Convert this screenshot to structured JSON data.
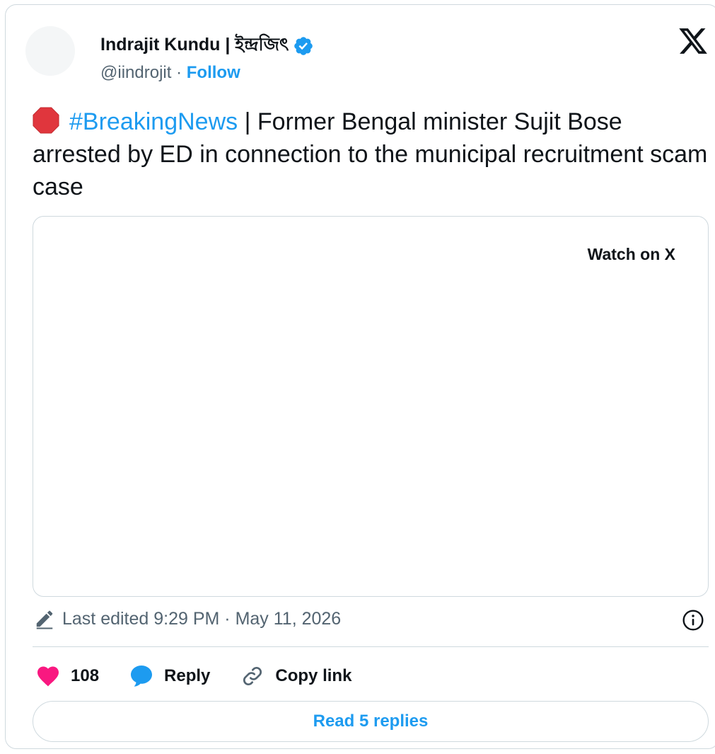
{
  "author": {
    "name": "Indrajit Kundu | ইন্দ্রজিৎ",
    "handle": "@iindrojit",
    "separator": "·",
    "follow_label": "Follow"
  },
  "tweet": {
    "hashtag": "#BreakingNews",
    "text": " | Former Bengal minister Sujit Bose arrested by ED in connection to the municipal recruitment scam case"
  },
  "media": {
    "watch_label": "Watch on X"
  },
  "meta": {
    "edited_text": "Last edited 9:29 PM · May 11, 2026"
  },
  "actions": {
    "like_count": "108",
    "reply_label": "Reply",
    "copy_link_label": "Copy link"
  },
  "footer": {
    "read_replies_label": "Read 5 replies"
  },
  "colors": {
    "accent": "#1d9bf0",
    "like": "#f91880",
    "stop": "#e0363d",
    "text": "#0f1419",
    "muted": "#536471",
    "border": "#cfd9de"
  },
  "icons": [
    "verified-badge-icon",
    "x-logo-icon",
    "stop-sign-icon",
    "pencil-icon",
    "info-icon",
    "heart-icon",
    "reply-bubble-icon",
    "link-icon"
  ]
}
